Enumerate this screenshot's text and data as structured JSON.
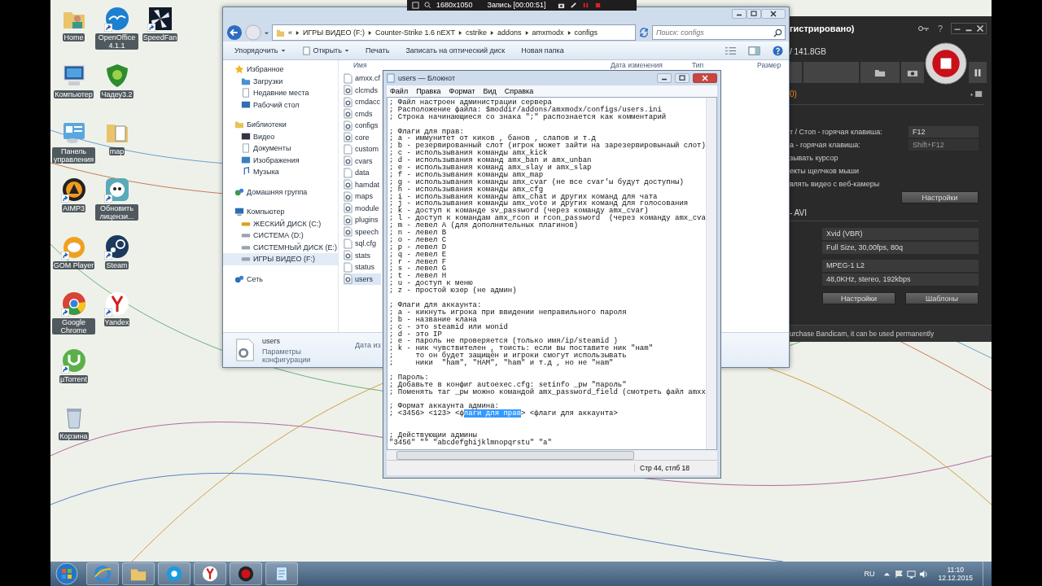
{
  "desktop": {
    "icon_rows": [
      [
        {
          "label": "Home",
          "kind": "user-folder",
          "shortcut": false
        },
        {
          "label": "OpenOffice 4.1.1",
          "kind": "gull",
          "shortcut": true
        },
        {
          "label": "SpeedFan",
          "kind": "fan",
          "shortcut": true
        }
      ],
      [
        {
          "label": "Компьютер",
          "kind": "computer",
          "shortcut": false
        },
        {
          "label": "Чадеу3.2",
          "kind": "shield",
          "shortcut": false
        }
      ],
      [
        {
          "label": "Панель управления",
          "kind": "control-panel",
          "shortcut": false
        },
        {
          "label": "map",
          "kind": "folder",
          "shortcut": false
        }
      ],
      [
        {
          "label": "AIMP3",
          "kind": "aimp",
          "shortcut": true
        },
        {
          "label": "Обновить лицензи...",
          "kind": "skull",
          "shortcut": true
        }
      ],
      [
        {
          "label": "GOM Player",
          "kind": "gom",
          "shortcut": true
        },
        {
          "label": "Steam",
          "kind": "steam",
          "shortcut": true
        }
      ],
      [
        {
          "label": "Google Chrome",
          "kind": "chrome",
          "shortcut": true
        },
        {
          "label": "Yandex",
          "kind": "yandex",
          "shortcut": true
        }
      ],
      [
        {
          "label": "µTorrent",
          "kind": "torrent",
          "shortcut": true
        }
      ],
      [
        {
          "label": "Корзина",
          "kind": "trash",
          "shortcut": false
        }
      ]
    ]
  },
  "recorder_bar": {
    "resolution": "1680x1050",
    "status": "Запись [00:00:51]"
  },
  "explorer": {
    "breadcrumb_overflow": "«",
    "path": [
      "ИГРЫ ВИДЕО (F:)",
      "Counter-Strike 1.6 nEXT",
      "cstrike",
      "addons",
      "amxmodx",
      "configs"
    ],
    "search_placeholder": "Поиск: configs",
    "toolbar": [
      {
        "label": "Упорядочить",
        "kind": "menu"
      },
      {
        "label": "Открыть",
        "kind": "open"
      },
      {
        "label": "Печать",
        "kind": "plain"
      },
      {
        "label": "Записать на оптический диск",
        "kind": "plain"
      },
      {
        "label": "Новая папка",
        "kind": "plain"
      }
    ],
    "nav": [
      {
        "label": "Избранное",
        "kind": "star",
        "selected": false,
        "children": [
          {
            "label": "Загрузки",
            "kind": "downloads",
            "selected": false
          },
          {
            "label": "Недавние места",
            "kind": "recent",
            "selected": false
          },
          {
            "label": "Рабочий стол",
            "kind": "desktop",
            "selected": false
          }
        ]
      },
      {
        "label": "Библиотеки",
        "kind": "library",
        "selected": false,
        "children": [
          {
            "label": "Видео",
            "kind": "video",
            "selected": false
          },
          {
            "label": "Документы",
            "kind": "documents",
            "selected": false
          },
          {
            "label": "Изображения",
            "kind": "pictures",
            "selected": false
          },
          {
            "label": "Музыка",
            "kind": "music",
            "selected": false
          }
        ]
      },
      {
        "label": "Домашняя группа",
        "kind": "homegroup",
        "selected": false
      },
      {
        "label": "Компьютер",
        "kind": "computer",
        "selected": false,
        "children": [
          {
            "label": "ЖЕСКИЙ ДИСК (C:)",
            "kind": "system-drive",
            "selected": false
          },
          {
            "label": "СИСТЕМА (D:)",
            "kind": "drive",
            "selected": false
          },
          {
            "label": "СИСТЕМНЫЙ ДИСК (E:)",
            "kind": "drive",
            "selected": false
          },
          {
            "label": "ИГРЫ ВИДЕО (F:)",
            "kind": "drive",
            "selected": true
          }
        ]
      },
      {
        "label": "Сеть",
        "kind": "network",
        "selected": false
      }
    ],
    "columns": [
      "Имя",
      "Дата изменения",
      "Тип",
      "Размер"
    ],
    "files": [
      {
        "name": "amxx.cf",
        "kind": "text",
        "selected": false
      },
      {
        "name": "clcmds",
        "kind": "config",
        "selected": false
      },
      {
        "name": "cmdacc",
        "kind": "config",
        "selected": false
      },
      {
        "name": "cmds",
        "kind": "config",
        "selected": false
      },
      {
        "name": "configs",
        "kind": "config",
        "selected": false
      },
      {
        "name": "core",
        "kind": "config",
        "selected": false
      },
      {
        "name": "custom",
        "kind": "text",
        "selected": false
      },
      {
        "name": "cvars",
        "kind": "config",
        "selected": false
      },
      {
        "name": "data",
        "kind": "text",
        "selected": false
      },
      {
        "name": "hamdat",
        "kind": "config",
        "selected": false
      },
      {
        "name": "maps",
        "kind": "config",
        "selected": false
      },
      {
        "name": "module",
        "kind": "config",
        "selected": false
      },
      {
        "name": "plugins",
        "kind": "config",
        "selected": false
      },
      {
        "name": "speech",
        "kind": "config",
        "selected": false
      },
      {
        "name": "sql.cfg",
        "kind": "text",
        "selected": false
      },
      {
        "name": "stats",
        "kind": "config",
        "selected": false
      },
      {
        "name": "status",
        "kind": "text",
        "selected": false
      },
      {
        "name": "users",
        "kind": "config",
        "selected": true
      }
    ],
    "details": {
      "name": "users",
      "type": "Параметры конфигурации",
      "field": "Дата из"
    }
  },
  "notepad": {
    "title": "users — Блокнот",
    "menu": [
      "Файл",
      "Правка",
      "Формат",
      "Вид",
      "Справка"
    ],
    "lines": [
      {
        "kind": "text",
        "text": "; Файл настроен администрации сервера"
      },
      {
        "kind": "text",
        "text": "; Расположение файла: $moddir/addons/amxmodx/configs/users.ini"
      },
      {
        "kind": "text",
        "text": "; Строка начинающиеся со знака \";\" распознается как комментарий"
      },
      {
        "kind": "blank"
      },
      {
        "kind": "text",
        "text": "; Флаги для прав:"
      },
      {
        "kind": "text",
        "text": "; a - иммунитет от киков , банов , слапов и т.д"
      },
      {
        "kind": "text",
        "text": "; b - резервированный слот (игрок может зайти на зарезервировынаый слот)"
      },
      {
        "kind": "text",
        "text": "; c - использывания команды amx_kick"
      },
      {
        "kind": "text",
        "text": "; d - использывания команд amx_ban и amx_unban"
      },
      {
        "kind": "text",
        "text": "; e - использывания команд amx_slay и amx_slap"
      },
      {
        "kind": "text",
        "text": "; f - использывания команды amx_map"
      },
      {
        "kind": "text",
        "text": "; g - использывания команды amx_cvar (не все cvar'ы будут доступны)"
      },
      {
        "kind": "text",
        "text": "; h - использывания команды amx_cfg"
      },
      {
        "kind": "text",
        "text": "; i - использывания команды amx_chat и других команд для чата"
      },
      {
        "kind": "text",
        "text": "; j - использывания команды amx_vote и других команд для голосования"
      },
      {
        "kind": "text",
        "text": "; k - доступ к команде sv_password (через команду amx_cvar)"
      },
      {
        "kind": "text",
        "text": "; l - доступ к командам amx_rcon и rcon_password  (через команду amx_cva"
      },
      {
        "kind": "text",
        "text": "; m - левел A (для дополнительных плагинов)"
      },
      {
        "kind": "text",
        "text": "; n - левел B"
      },
      {
        "kind": "text",
        "text": "; o - левел C"
      },
      {
        "kind": "text",
        "text": "; p - левел D"
      },
      {
        "kind": "text",
        "text": "; q - левел E"
      },
      {
        "kind": "text",
        "text": "; r - левел F"
      },
      {
        "kind": "text",
        "text": "; s - левел G"
      },
      {
        "kind": "text",
        "text": "; t - левел H"
      },
      {
        "kind": "text",
        "text": "; u - доступ к меню"
      },
      {
        "kind": "text",
        "text": "; z - простой юзер (не админ)"
      },
      {
        "kind": "blank"
      },
      {
        "kind": "text",
        "text": "; Флаги для аккаунта:"
      },
      {
        "kind": "text",
        "text": "; a - кикнуть игрока при ввидении неправильного пароля"
      },
      {
        "kind": "text",
        "text": "; b - название клана"
      },
      {
        "kind": "text",
        "text": "; c - это steamid или wonid"
      },
      {
        "kind": "text",
        "text": "; d - это IP"
      },
      {
        "kind": "text",
        "text": "; e - пароль не проверяется (только имя/ip/steamid )"
      },
      {
        "kind": "text",
        "text": "; k - ник чувствителен , тоисть: если вы поставите ник \"нam\""
      },
      {
        "kind": "text",
        "text": ";     то он будет защищён и игроки смогут использывать"
      },
      {
        "kind": "text",
        "text": ";     ники  \"ham\", \"HAM\", \"ham\" и т.д , но не \"нam\""
      },
      {
        "kind": "blank"
      },
      {
        "kind": "text",
        "text": "; Пароль:"
      },
      {
        "kind": "text",
        "text": "; Добавьте в конфиг autoexec.cfg: setinfo _pw \"пароль\""
      },
      {
        "kind": "text",
        "text": "; Поменять таг _pw можно командой amx_password_field (смотреть файл amxx"
      },
      {
        "kind": "blank"
      },
      {
        "kind": "text",
        "text": "; Формат аккаунта админа:"
      },
      {
        "kind": "selection",
        "before": "; <3456> <123> <ф",
        "selected": "лаги для прав",
        "after": "> <флаги для аккаунта>"
      },
      {
        "kind": "blank"
      },
      {
        "kind": "blank"
      },
      {
        "kind": "text",
        "text": "; Действующии админы"
      },
      {
        "kind": "text",
        "text": "\"3456\" \"\" \"abcdefghijklmnopqrstu\" \"a\""
      }
    ],
    "status": "Стр 44, стлб 18"
  },
  "bandicam": {
    "title": "гистрировано)",
    "help": "?",
    "disk": "/ 141.8GB",
    "section": "0)",
    "settings": [
      {
        "label": "т / Стоп - горячая клавиша:",
        "value": "F12",
        "disabled": false
      },
      {
        "label": "а - горячая клавиша:",
        "value": "Shift+F12",
        "disabled": true
      }
    ],
    "options": [
      "зывать курсор",
      "екты щелчков мыши",
      "влять видео с веб-камеры"
    ],
    "settings_button": "Настройки",
    "format": "- AVI",
    "video": [
      "Xvid (VBR)",
      "Full Size, 30,00fps, 80q"
    ],
    "audio": [
      "MPEG-1 L2",
      "48,0KHz, stereo, 192kbps"
    ],
    "buttons": [
      "Настройки",
      "Шаблоны"
    ],
    "notice": "urchase Bandicam, it can be used permanently"
  },
  "taskbar": {
    "apps": [
      {
        "kind": "ie"
      },
      {
        "kind": "explorer"
      },
      {
        "kind": "skype"
      },
      {
        "kind": "yandex"
      },
      {
        "kind": "record"
      },
      {
        "kind": "notepad"
      }
    ],
    "language": "RU",
    "time": "11:10",
    "date": "12.12.2015"
  }
}
